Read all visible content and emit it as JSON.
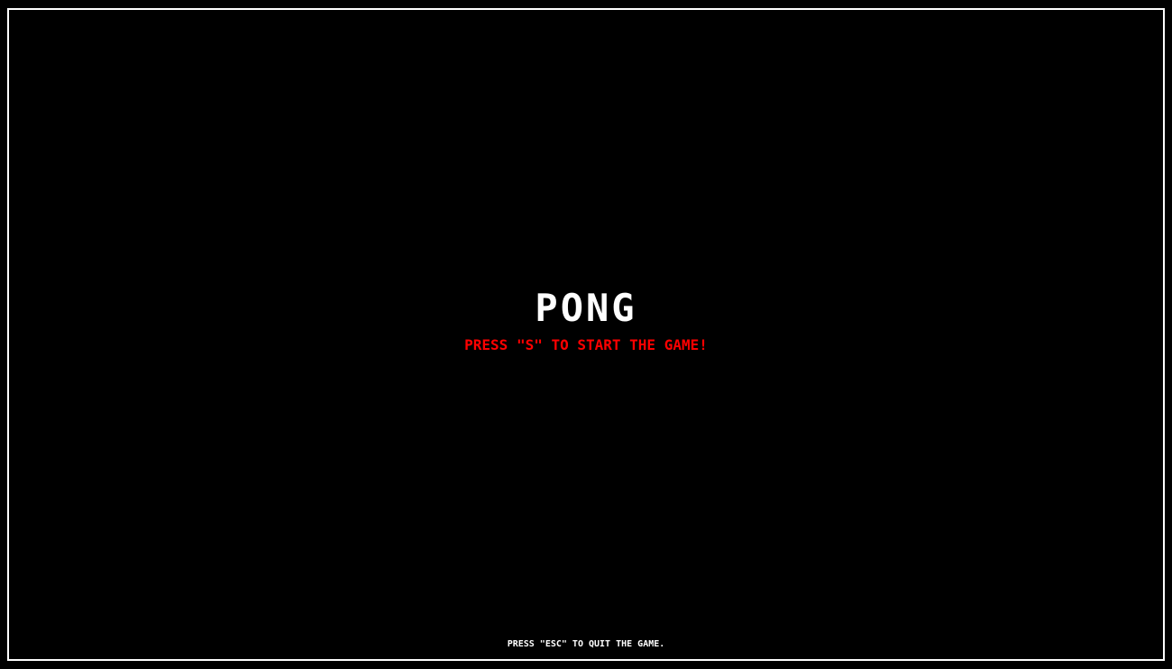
{
  "game": {
    "title": "PONG",
    "start_prompt": "PRESS \"S\" TO START THE GAME!",
    "quit_hint": "PRESS \"ESC\" TO QUIT THE GAME."
  },
  "colors": {
    "background": "#000000",
    "frame": "#ffffff",
    "title": "#ffffff",
    "start_prompt": "#ff0000",
    "quit_hint": "#ffffff"
  }
}
